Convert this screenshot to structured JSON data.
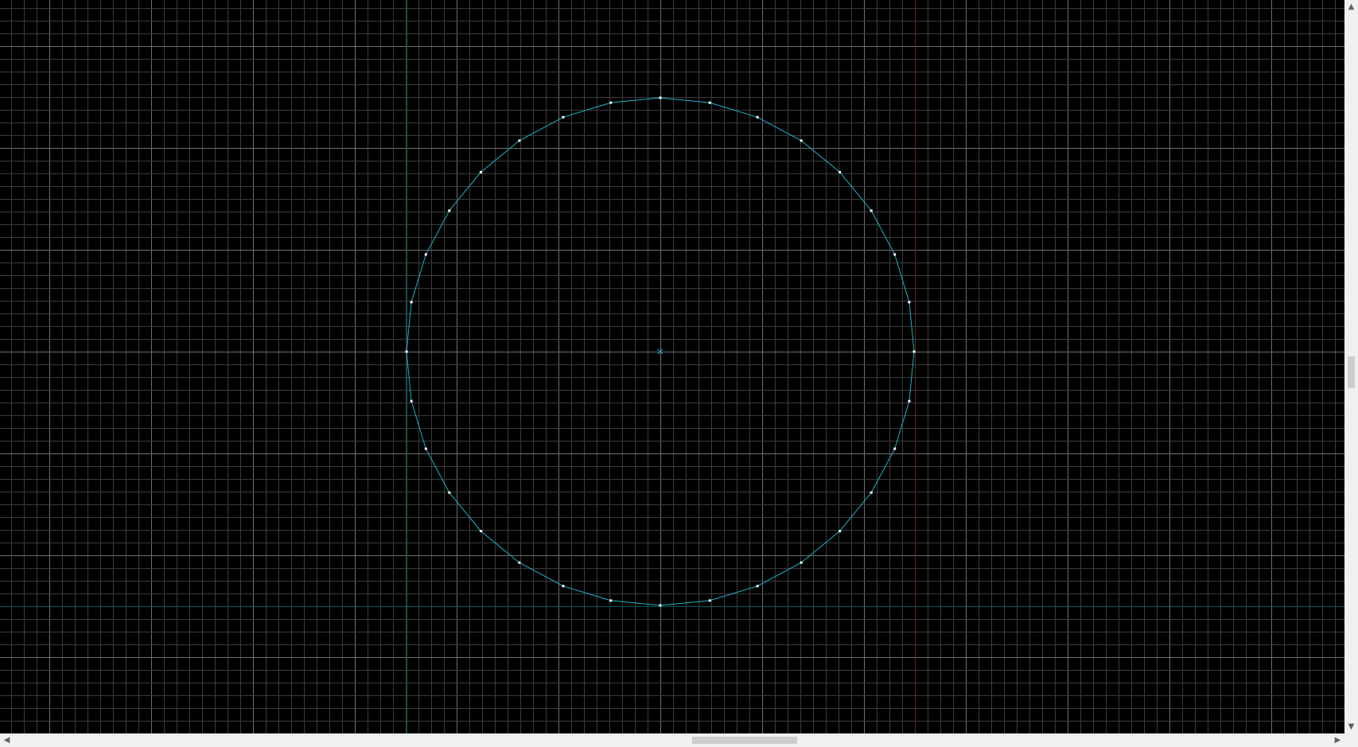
{
  "window": {
    "background": "#000000",
    "chrome_color": "#f0f0f0"
  },
  "viewport": {
    "grid": {
      "minor_color": "#3c3c3c",
      "major_color": "#6e6e6e",
      "axis_color": "#005c66",
      "boundary_color": "#5a2a1a"
    },
    "shape": {
      "type": "polygon-circle",
      "vertex_count": 32,
      "stroke_color": "#1bb3c6",
      "vertex_color": "#ffffff",
      "center_marker_color": "#1bb3c6"
    }
  },
  "scrollbars": {
    "up_icon": "▲",
    "down_icon": "▼",
    "left_icon": "◀",
    "right_icon": "▶"
  }
}
